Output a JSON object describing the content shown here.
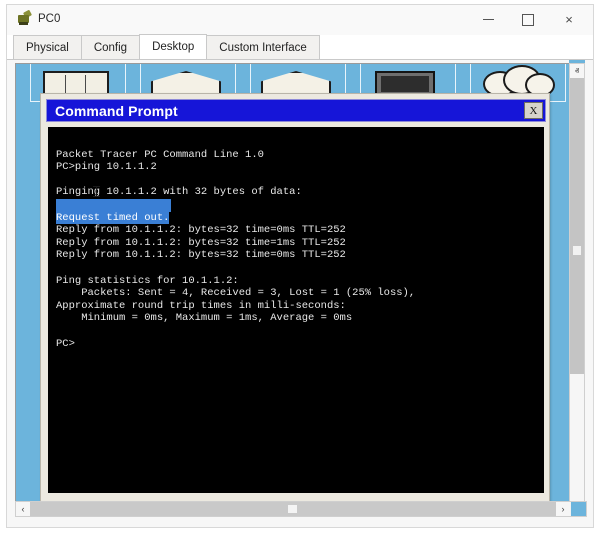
{
  "window": {
    "title": "PC0",
    "icon": "pt-pc-icon",
    "controls": {
      "minimize": "minimize-icon",
      "maximize": "maximize-icon",
      "close": "×"
    }
  },
  "tabs": [
    {
      "label": "Physical",
      "active": false
    },
    {
      "label": "Config",
      "active": false
    },
    {
      "label": "Desktop",
      "active": true
    },
    {
      "label": "Custom Interface",
      "active": false
    }
  ],
  "command_prompt": {
    "title": "Command Prompt",
    "close_label": "X",
    "lines": [
      {
        "text": "",
        "selected": false
      },
      {
        "text": "Packet Tracer PC Command Line 1.0",
        "selected": false
      },
      {
        "text": "PC>ping 10.1.1.2",
        "selected": false
      },
      {
        "text": "",
        "selected": false
      },
      {
        "text": "Pinging 10.1.1.2 with 32 bytes of data:",
        "selected": false
      },
      {
        "text": "",
        "selected": "blank-highlight"
      },
      {
        "text": "Request timed out.",
        "selected": true
      },
      {
        "text": "Reply from 10.1.1.2: bytes=32 time=0ms TTL=252",
        "selected": false
      },
      {
        "text": "Reply from 10.1.1.2: bytes=32 time=1ms TTL=252",
        "selected": false
      },
      {
        "text": "Reply from 10.1.1.2: bytes=32 time=0ms TTL=252",
        "selected": false
      },
      {
        "text": "",
        "selected": false
      },
      {
        "text": "Ping statistics for 10.1.1.2:",
        "selected": false
      },
      {
        "text": "    Packets: Sent = 4, Received = 3, Lost = 1 (25% loss),",
        "selected": false
      },
      {
        "text": "Approximate round trip times in milli-seconds:",
        "selected": false
      },
      {
        "text": "    Minimum = 0ms, Maximum = 1ms, Average = 0ms",
        "selected": false
      },
      {
        "text": "",
        "selected": false
      },
      {
        "text": "PC>",
        "selected": false
      }
    ]
  },
  "desktop": {
    "icons": [
      {
        "art": "doc",
        "name": "desktop-icon-tile-1"
      },
      {
        "art": "fold",
        "name": "desktop-icon-tile-2"
      },
      {
        "art": "fold",
        "name": "desktop-icon-tile-3"
      },
      {
        "art": "mon",
        "name": "desktop-icon-tile-4"
      },
      {
        "art": "cloud",
        "name": "desktop-icon-tile-5"
      }
    ],
    "background_color": "#6cb4dc"
  },
  "scrollbars": {
    "vertical": {
      "up": "ⱏ",
      "down": "ⱟ"
    },
    "horizontal": {
      "left": "‹",
      "right": "›"
    }
  },
  "colors": {
    "titlebar_blue": "#1615d8",
    "selection_blue": "#3a7fd5",
    "terminal_bg": "#000000",
    "terminal_fg": "#e8e8e8",
    "window_chrome": "#ece9e0"
  }
}
